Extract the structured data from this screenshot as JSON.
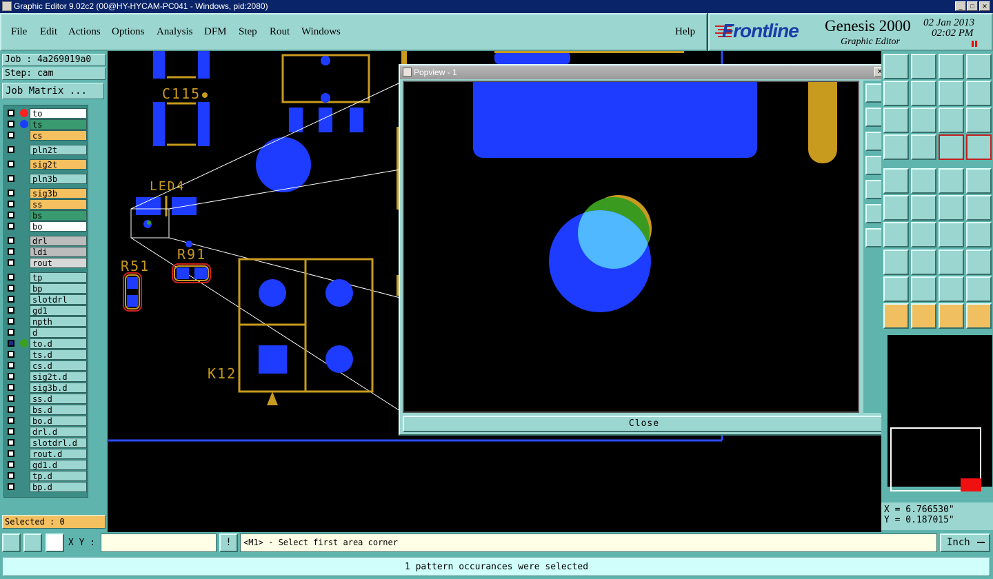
{
  "window": {
    "title": "Graphic Editor 9.02c2 (00@HY-HYCAM-PC041 - Windows, pid:2080)"
  },
  "menu": {
    "items": [
      "File",
      "Edit",
      "Actions",
      "Options",
      "Analysis",
      "DFM",
      "Step",
      "Rout",
      "Windows"
    ],
    "help": "Help"
  },
  "brand": {
    "logo": "Frontline",
    "product": "Genesis 2000",
    "subtitle": "Graphic Editor",
    "date": "02 Jan 2013",
    "time": "02:02 PM"
  },
  "job": {
    "job_label": "Job : 4a269019a0",
    "step_label": "Step: cam",
    "matrix_button": "Job Matrix ..."
  },
  "layers": [
    {
      "name": "to",
      "color": "#ffffff",
      "dot": "#ff2020"
    },
    {
      "name": "ts",
      "color": "#3a9a70",
      "dot": "#1a3cff"
    },
    {
      "name": "cs",
      "color": "#f5c060",
      "dot": ""
    },
    {
      "name": "pln2t",
      "color": "#9cd6d0",
      "dot": ""
    },
    {
      "name": "sig2t",
      "color": "#f5c060",
      "dot": ""
    },
    {
      "name": "pln3b",
      "color": "#9cd6d0",
      "dot": ""
    },
    {
      "name": "sig3b",
      "color": "#f5c060",
      "dot": ""
    },
    {
      "name": "ss",
      "color": "#f5c060",
      "dot": ""
    },
    {
      "name": "bs",
      "color": "#3a9a70",
      "dot": ""
    },
    {
      "name": "bo",
      "color": "#ffffff",
      "dot": ""
    },
    {
      "name": "drl",
      "color": "#bcbcbc",
      "dot": ""
    },
    {
      "name": "ldi",
      "color": "#bcbcbc",
      "dot": ""
    },
    {
      "name": "rout",
      "color": "#d8d8d8",
      "dot": ""
    },
    {
      "name": "tp",
      "color": "#9cd6d0",
      "dot": ""
    },
    {
      "name": "bp",
      "color": "#9cd6d0",
      "dot": ""
    },
    {
      "name": "slotdrl",
      "color": "#9cd6d0",
      "dot": ""
    },
    {
      "name": "gd1",
      "color": "#9cd6d0",
      "dot": ""
    },
    {
      "name": "npth",
      "color": "#9cd6d0",
      "dot": ""
    },
    {
      "name": "d",
      "color": "#9cd6d0",
      "dot": ""
    },
    {
      "name": "to.d",
      "color": "#9cd6d0",
      "dot": "#3aa020"
    },
    {
      "name": "ts.d",
      "color": "#9cd6d0",
      "dot": ""
    },
    {
      "name": "cs.d",
      "color": "#9cd6d0",
      "dot": ""
    },
    {
      "name": "sig2t.d",
      "color": "#9cd6d0",
      "dot": ""
    },
    {
      "name": "sig3b.d",
      "color": "#9cd6d0",
      "dot": ""
    },
    {
      "name": "ss.d",
      "color": "#9cd6d0",
      "dot": ""
    },
    {
      "name": "bs.d",
      "color": "#9cd6d0",
      "dot": ""
    },
    {
      "name": "bo.d",
      "color": "#9cd6d0",
      "dot": ""
    },
    {
      "name": "drl.d",
      "color": "#9cd6d0",
      "dot": ""
    },
    {
      "name": "slotdrl.d",
      "color": "#9cd6d0",
      "dot": ""
    },
    {
      "name": "rout.d",
      "color": "#9cd6d0",
      "dot": ""
    },
    {
      "name": "gd1.d",
      "color": "#9cd6d0",
      "dot": ""
    },
    {
      "name": "tp.d",
      "color": "#9cd6d0",
      "dot": ""
    },
    {
      "name": "bp.d",
      "color": "#9cd6d0",
      "dot": ""
    }
  ],
  "selected": "Selected : 0",
  "canvas_labels": {
    "c115": "C115",
    "led4": "LED4",
    "r51": "R51",
    "r91": "R91",
    "k12": "K12"
  },
  "popup": {
    "title": "Popview - 1",
    "close": "Close"
  },
  "coords": {
    "x": "X = 6.766530\"",
    "y": "Y = 0.187015\""
  },
  "bottom": {
    "xy_label": "X Y :",
    "xy_value": "",
    "prompt": "<M1> - Select first area corner",
    "units": "Inch"
  },
  "status": {
    "message": "1 pattern occurances were selected"
  },
  "colors": {
    "panel": "#5fb5ae",
    "button": "#9cd6d0",
    "pad_blue": "#1e3cff",
    "copper_gold": "#c89a1e"
  }
}
